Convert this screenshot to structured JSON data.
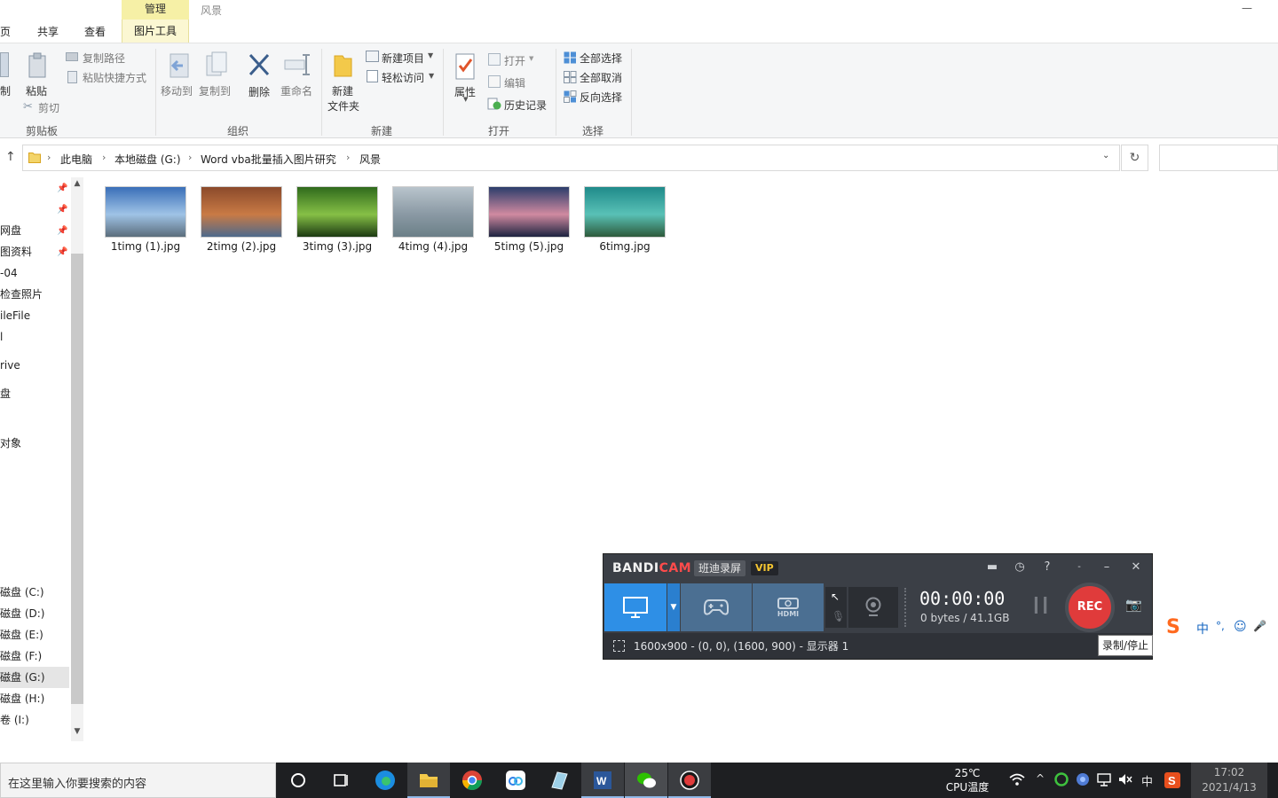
{
  "window": {
    "title": "风景",
    "context_tab": "管理",
    "tabs": [
      "页",
      "共享",
      "查看"
    ],
    "context_subtab": "图片工具"
  },
  "ribbon": {
    "clipboard": {
      "copy": "制",
      "paste": "粘贴",
      "copy_path": "复制路径",
      "paste_shortcut": "粘贴快捷方式",
      "cut": "剪切",
      "label": "剪贴板"
    },
    "organize": {
      "move_to": "移动到",
      "copy_to": "复制到",
      "delete": "删除",
      "rename": "重命名",
      "label": "组织"
    },
    "new": {
      "new_folder_line1": "新建",
      "new_folder_line2": "文件夹",
      "new_item": "新建项目",
      "easy_access": "轻松访问",
      "label": "新建"
    },
    "open": {
      "properties": "属性",
      "open": "打开",
      "edit": "编辑",
      "history": "历史记录",
      "label": "打开"
    },
    "select": {
      "select_all": "全部选择",
      "select_none": "全部取消",
      "invert": "反向选择",
      "label": "选择"
    }
  },
  "address": {
    "crumbs": [
      "此电脑",
      "本地磁盘 (G:)",
      "Word vba批量插入图片研究",
      "风景"
    ]
  },
  "nav": {
    "items": [
      {
        "label": "网盘",
        "pinned": true
      },
      {
        "label": "图资料",
        "pinned": true
      },
      {
        "label": "-04",
        "pinned": false
      },
      {
        "label": "检查照片",
        "pinned": false
      },
      {
        "label": "ileFile",
        "pinned": false
      },
      {
        "label": "l",
        "pinned": false
      },
      {
        "label": "rive",
        "pinned": false
      },
      {
        "label": "盘",
        "pinned": false
      },
      {
        "label": "",
        "pinned": false
      },
      {
        "label": "对象",
        "pinned": false
      }
    ],
    "drives": [
      {
        "label": "磁盘 (C:)",
        "selected": false
      },
      {
        "label": "磁盘 (D:)",
        "selected": false
      },
      {
        "label": "磁盘 (E:)",
        "selected": false
      },
      {
        "label": "磁盘 (F:)",
        "selected": false
      },
      {
        "label": "磁盘 (G:)",
        "selected": true
      },
      {
        "label": "磁盘 (H:)",
        "selected": false
      },
      {
        "label": "卷 (I:)",
        "selected": false
      }
    ]
  },
  "files": [
    {
      "name": "1timg (1).jpg",
      "colors": [
        "#3a6fb8",
        "#9fc3e6",
        "#5b6d7c"
      ]
    },
    {
      "name": "2timg (2).jpg",
      "colors": [
        "#8b4a2b",
        "#c97a45",
        "#4e6a8c"
      ]
    },
    {
      "name": "3timg (3).jpg",
      "colors": [
        "#2f6a1c",
        "#86c046",
        "#1c3a12"
      ]
    },
    {
      "name": "4timg (4).jpg",
      "colors": [
        "#b9c4cc",
        "#8a99a4",
        "#6b7f87"
      ]
    },
    {
      "name": "5timg (5).jpg",
      "colors": [
        "#2b3d6b",
        "#d08aa0",
        "#1c2340"
      ]
    },
    {
      "name": "6timg.jpg",
      "colors": [
        "#1f8a8a",
        "#59c1b6",
        "#2d5a3b"
      ]
    }
  ],
  "bandicam": {
    "logo_a": "BANDI",
    "logo_b": "CAM",
    "subtitle": "班迪录屏",
    "vip": "VIP",
    "timer": "00:00:00",
    "size": "0 bytes / 41.1GB",
    "rec_label": "REC",
    "region": "1600x900 - (0, 0), (1600, 900) - 显示器 1",
    "tooltip": "录制/停止",
    "hdmi_label": "HDMI"
  },
  "ime": {
    "items": [
      "中",
      "°,",
      "☺",
      "🎤"
    ]
  },
  "taskbar": {
    "search_placeholder": "在这里输入你要搜索的内容",
    "weather_temp": "25℃",
    "weather_label": "CPU温度",
    "ime_mode": "中",
    "time": "17:02",
    "date": "2021/4/13"
  },
  "colors": {
    "accent": "#2e8fe6",
    "rec_red": "#e03b3b",
    "context_tab": "#f6f0a6"
  }
}
